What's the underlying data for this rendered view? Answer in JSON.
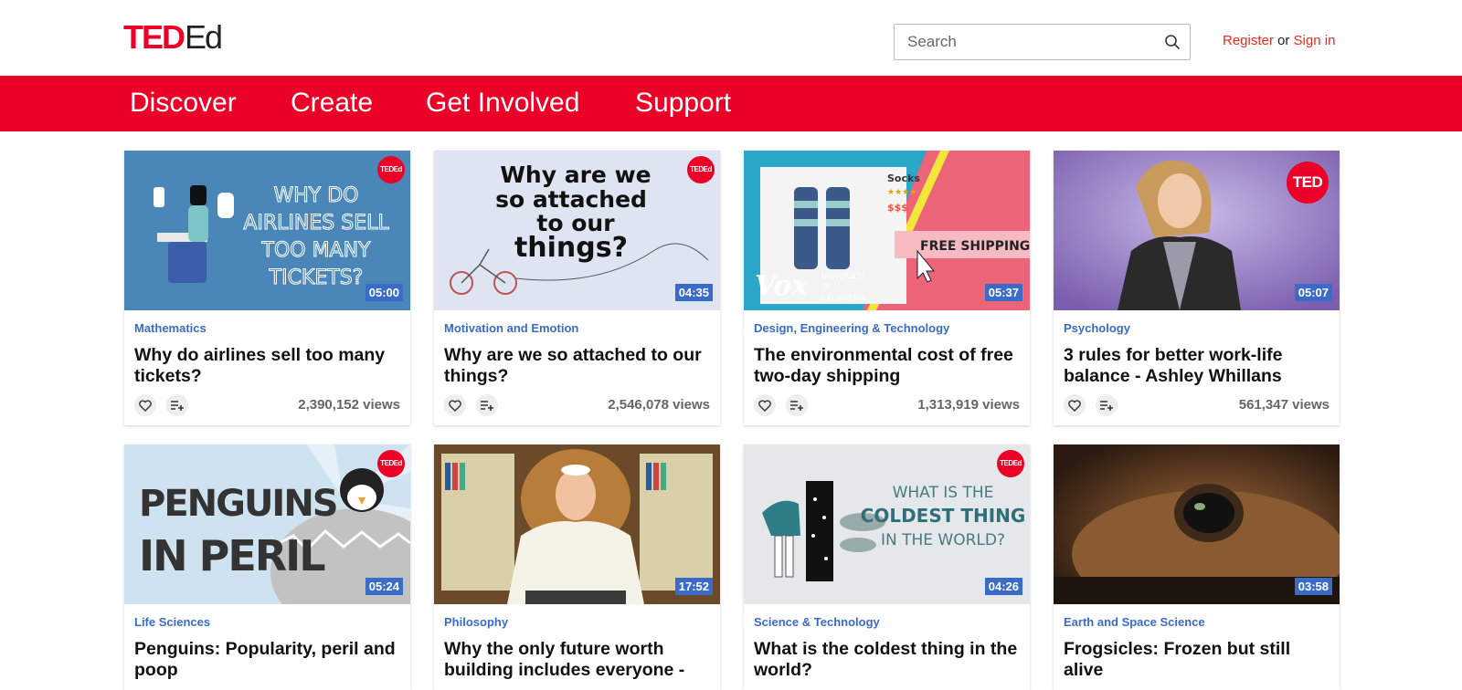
{
  "header": {
    "logo_ted": "TED",
    "logo_ed": "Ed",
    "search_placeholder": "Search",
    "register": "Register",
    "or": "or",
    "sign_in": "Sign in"
  },
  "nav": {
    "items": [
      {
        "label": "Discover"
      },
      {
        "label": "Create"
      },
      {
        "label": "Get Involved"
      },
      {
        "label": "Support"
      }
    ]
  },
  "badge_text": {
    "ted_ed": "TEDEd",
    "ted": "TED"
  },
  "colors": {
    "brand_red": "#eb0028",
    "accent_blue": "#3a6bc6"
  },
  "cards": [
    {
      "category": "Mathematics",
      "title": "Why do airlines sell too many tickets?",
      "views": "2,390,152 views",
      "duration": "05:00",
      "thumb_text": [
        "WHY DO",
        "AIRLINES SELL",
        "TOO MANY",
        "TICKETS?"
      ]
    },
    {
      "category": "Motivation and Emotion",
      "title": "Why are we so attached to our things?",
      "views": "2,546,078 views",
      "duration": "04:35",
      "thumb_text": [
        "Why are we",
        "so attached",
        "to our",
        "things?"
      ]
    },
    {
      "category": "Design, Engineering & Technology",
      "title": "The environmental cost of free two-day shipping",
      "views": "1,313,919 views",
      "duration": "05:37",
      "thumb_text": [
        "Socks",
        "★★★★",
        "$$$",
        "FREE SHIPPING",
        "Vox",
        "UNIVERSITY",
        "OF",
        "CALIFORNIA"
      ]
    },
    {
      "category": "Psychology",
      "title": "3 rules for better work-life balance - Ashley Whillans",
      "views": "561,347 views",
      "duration": "05:07",
      "thumb_text": []
    },
    {
      "category": "Life Sciences",
      "title": "Penguins: Popularity, peril and poop",
      "views": "",
      "duration": "05:24",
      "thumb_text": [
        "PENGUINS",
        "IN PERIL"
      ]
    },
    {
      "category": "Philosophy",
      "title": "Why the only future worth building includes everyone - Pope Francis",
      "views": "",
      "duration": "17:52",
      "thumb_text": []
    },
    {
      "category": "Science & Technology",
      "title": "What is the coldest thing in the world?",
      "views": "",
      "duration": "04:26",
      "thumb_text": [
        "WHAT IS THE",
        "COLDEST THING",
        "IN THE WORLD?"
      ]
    },
    {
      "category": "Earth and Space Science",
      "title": "Frogsicles: Frozen but still alive",
      "views": "",
      "duration": "03:58",
      "thumb_text": []
    }
  ]
}
